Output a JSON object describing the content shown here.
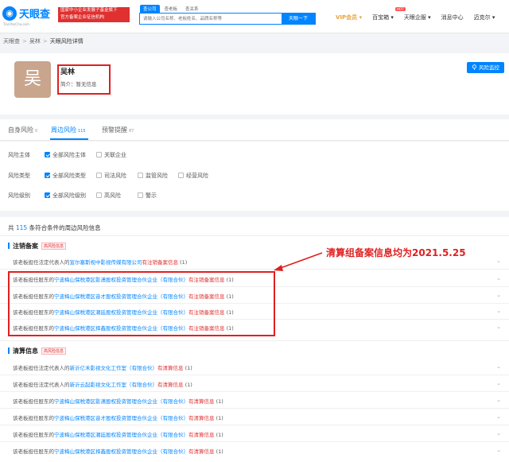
{
  "header": {
    "logo_text": "天眼查",
    "logo_sub": "TianYanCha.com",
    "gov_line1": "国家中小企业发展子基金旗下",
    "gov_line2": "官方备案企业征信机构",
    "search_tabs": [
      "查公司",
      "查老板",
      "查关系"
    ],
    "search_placeholder": "请输入公司名称、老板姓名、品牌名称等",
    "search_button": "天眼一下",
    "nav": {
      "vip": "VIP会员",
      "baibao": "百宝箱",
      "hot": "HOT",
      "enterprise": "天眼企服",
      "messages": "消息中心",
      "user": "迈克尔"
    }
  },
  "breadcrumb": [
    "天眼查",
    "吴林",
    "天眼风险详情"
  ],
  "profile": {
    "avatar_char": "吴",
    "name": "吴林",
    "intro": "简介：暂无信息",
    "monitor_button": "风险监控"
  },
  "tabs": [
    {
      "label": "自身风险",
      "count": "0"
    },
    {
      "label": "周边风险",
      "count": "115"
    },
    {
      "label": "预警提醒",
      "count": "87"
    }
  ],
  "filters": {
    "subject": {
      "label": "风险主体",
      "options": [
        {
          "text": "全部风险主体",
          "checked": true
        },
        {
          "text": "关联企业",
          "checked": false
        }
      ]
    },
    "type": {
      "label": "风险类型",
      "options": [
        {
          "text": "全部风险类型",
          "checked": true
        },
        {
          "text": "司法风险",
          "checked": false
        },
        {
          "text": "监管风险",
          "checked": false
        },
        {
          "text": "经营风险",
          "checked": false
        }
      ]
    },
    "level": {
      "label": "风险级别",
      "options": [
        {
          "text": "全部风险级别",
          "checked": true
        },
        {
          "text": "高风险",
          "checked": false
        },
        {
          "text": "警示",
          "checked": false
        }
      ]
    }
  },
  "results": {
    "total_prefix": "共",
    "total_num": "115",
    "total_suffix": "条符合条件的周边风险信息",
    "sections": [
      {
        "title": "注销备案",
        "tag": "高风险信息",
        "rows": [
          {
            "pre": "该老板担任法定代表人的",
            "link": "宣尔塞斯视中影视传媒有限公司",
            "hl": "有注销备案信息",
            "count": "(1)"
          },
          {
            "pre": "该老板担任股东的",
            "link": "宁波梅山保税港区影潇股权投资管理合伙企业（有限合伙）",
            "hl": "有注销备案信息",
            "count": "(1)"
          },
          {
            "pre": "该老板担任股东的",
            "link": "宁波梅山保税港区音才股权投资管理合伙企业（有限合伙）",
            "hl": "有注销备案信息",
            "count": "(1)"
          },
          {
            "pre": "该老板担任股东的",
            "link": "宁波梅山保税港区潮廷股权投资管理合伙企业（有限合伙）",
            "hl": "有注销备案信息",
            "count": "(1)"
          },
          {
            "pre": "该老板担任股东的",
            "link": "宁波梅山保税港区择鑫股权投资管理合伙企业（有限合伙）",
            "hl": "有注销备案信息",
            "count": "(1)"
          }
        ]
      },
      {
        "title": "清算信息",
        "tag": "高风险信息",
        "rows": [
          {
            "pre": "该老板担任法定代表人的",
            "link": "新沂亿禾影视文化工作室（有限合伙）",
            "hl": "有清算信息",
            "count": "(1)"
          },
          {
            "pre": "该老板担任法定代表人的",
            "link": "新沂云起影视文化工作室（有限合伙）",
            "hl": "有清算信息",
            "count": "(1)"
          },
          {
            "pre": "该老板担任股东的",
            "link": "宁波梅山保税港区影潇股权投资管理合伙企业（有限合伙）",
            "hl": "有清算信息",
            "count": "(1)"
          },
          {
            "pre": "该老板担任股东的",
            "link": "宁波梅山保税港区音才股权投资管理合伙企业（有限合伙）",
            "hl": "有清算信息",
            "count": "(1)"
          },
          {
            "pre": "该老板担任股东的",
            "link": "宁波梅山保税港区潮廷股权投资管理合伙企业（有限合伙）",
            "hl": "有清算信息",
            "count": "(1)"
          },
          {
            "pre": "该老板担任股东的",
            "link": "宁波梅山保税港区择鑫股权投资管理合伙企业（有限合伙）",
            "hl": "有清算信息",
            "count": "(1)"
          }
        ]
      }
    ]
  },
  "annotation": "清算组备案信息均为2021.5.25"
}
